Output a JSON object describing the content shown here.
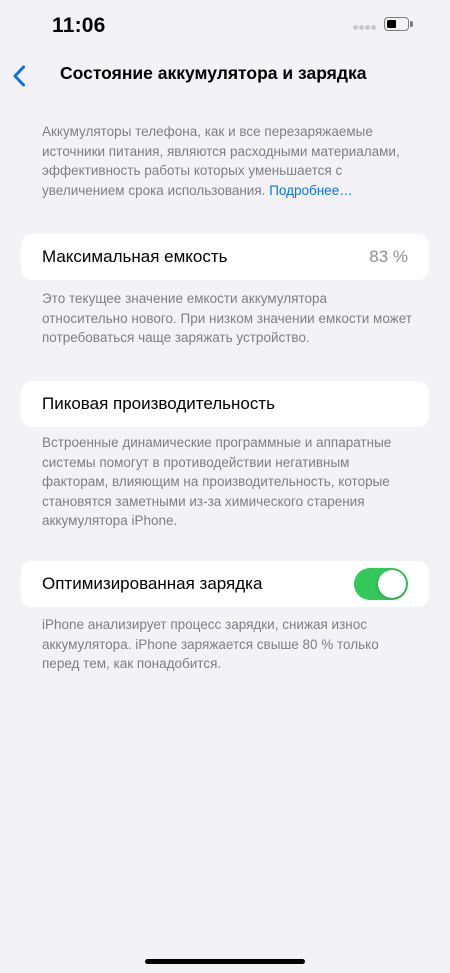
{
  "status_bar": {
    "time": "11:06",
    "battery_icon": "battery-low-icon",
    "signal_icon": "signal-dots-icon"
  },
  "nav": {
    "back_icon": "chevron-left-icon",
    "title": "Состояние аккумулятора и зарядка"
  },
  "intro": {
    "text": "Аккумуляторы телефона, как и все перезаряжаемые источники питания, являются расходными материалами, эффективность работы которых уменьшается с увеличением срока использования.",
    "link": "Подробнее…"
  },
  "max_capacity": {
    "label": "Максимальная емкость",
    "value": "83 %",
    "footnote": "Это текущее значение емкости аккумулятора относительно нового. При низком значении емкости может потребоваться чаще заряжать устройство."
  },
  "peak_performance": {
    "label": "Пиковая производительность",
    "footnote": "Встроенные динамические программные и аппаратные системы помогут в противодействии негативным факторам, влияющим на производительность, которые становятся заметными из-за химического старения аккумулятора iPhone."
  },
  "optimized_charging": {
    "label": "Оптимизированная зарядка",
    "enabled": true,
    "footnote": "iPhone анализирует процесс зарядки, снижая износ аккумулятора. iPhone заряжается свыше 80 % только перед тем, как понадобится."
  },
  "colors": {
    "background": "#f2f2f7",
    "accent": "#0a72e6",
    "toggle_on": "#34c759",
    "secondary_text": "#7f7f83"
  }
}
